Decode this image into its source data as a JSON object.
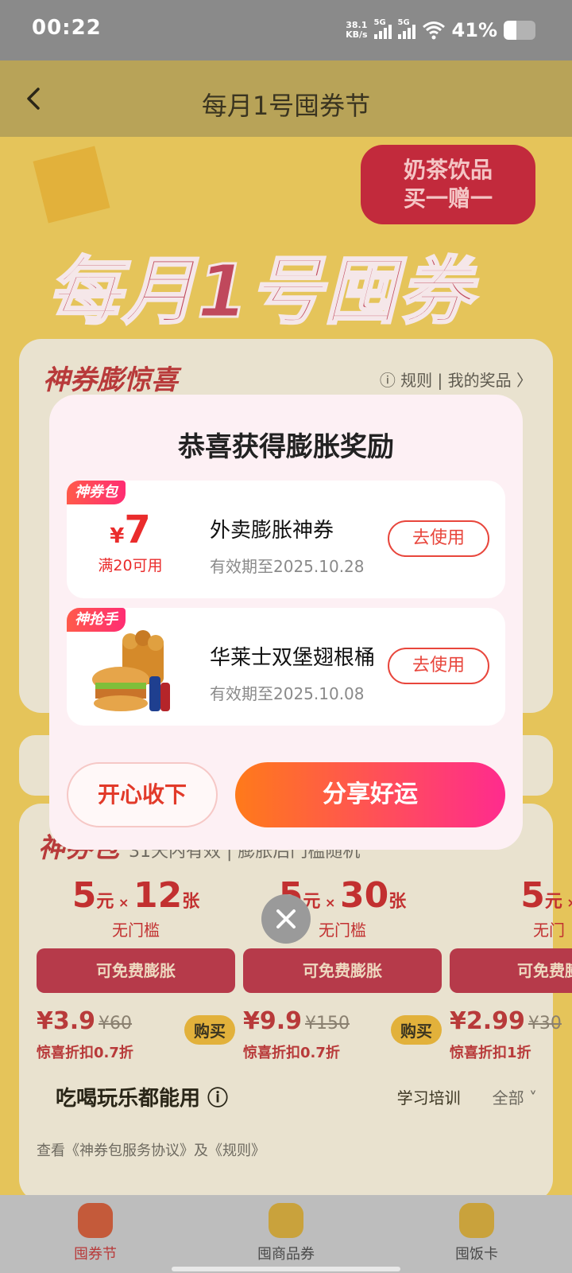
{
  "status_bar": {
    "time": "00:22",
    "net_speed_value": "38.1",
    "net_speed_unit": "KB/s",
    "sim1": "5G",
    "sim2": "5G",
    "battery_percent": "41%",
    "battery_level": 0.41
  },
  "header": {
    "title": "每月1号囤券节"
  },
  "background": {
    "hero_bubble_line1": "奶茶饮品",
    "hero_bubble_line2": "买一赠一",
    "hero_title": "每月1号囤券节",
    "card1_title": "神券膨惊喜",
    "card1_links": "ⓘ 规则 | 我的奖品 〉",
    "pack_title": "神券包",
    "pack_subtitle": "31天内有效 | 膨胀后门槛随机",
    "packs": [
      {
        "amount": "5",
        "unit": "元",
        "count": "12",
        "count_unit": "张",
        "threshold": "无门槛",
        "band": "可免费膨胀",
        "price": "¥3.9",
        "orig": "¥60",
        "buy": "购买",
        "discount": "惊喜折扣0.7折"
      },
      {
        "amount": "5",
        "unit": "元",
        "count": "30",
        "count_unit": "张",
        "threshold": "无门槛",
        "band": "可免费膨胀",
        "price": "¥9.9",
        "orig": "¥150",
        "buy": "购买",
        "discount": "惊喜折扣0.7折"
      },
      {
        "amount": "5",
        "unit": "元",
        "count": "",
        "count_unit": "",
        "threshold": "无门",
        "band": "可免费膨",
        "price": "¥2.99",
        "orig": "¥30",
        "buy": "",
        "discount": "惊喜折扣1折"
      }
    ],
    "cat_left": "吃喝玩乐都能用 ⓘ",
    "cat_mid": "学习培训",
    "cat_right": "全部 ˅",
    "agreement": "查看《神券包服务协议》及《规则》"
  },
  "modal": {
    "title": "恭喜获得膨胀奖励",
    "prizes": [
      {
        "ribbon": "神券包",
        "currency": "¥",
        "amount": "7",
        "condition": "满20可用",
        "name": "外卖膨胀神券",
        "expiry": "有效期至2025.10.28",
        "button": "去使用"
      },
      {
        "ribbon": "神抢手",
        "image": "burger-bucket-food-image",
        "name": "华莱士双堡翅根桶",
        "expiry": "有效期至2025.10.08",
        "button": "去使用"
      }
    ],
    "keep_button": "开心收下",
    "share_button": "分享好运"
  },
  "bottom_nav": {
    "items": [
      {
        "label": "囤券节",
        "icon": "home-icon",
        "active": true
      },
      {
        "label": "囤商品券",
        "icon": "coupon-icon",
        "active": false
      },
      {
        "label": "囤饭卡",
        "icon": "card-icon",
        "active": false
      }
    ]
  },
  "colors": {
    "accent_red": "#e8463c",
    "share_gradient_start": "#ff7a1a",
    "share_gradient_end": "#ff2b8e",
    "modal_bg": "#fdf0f4"
  }
}
